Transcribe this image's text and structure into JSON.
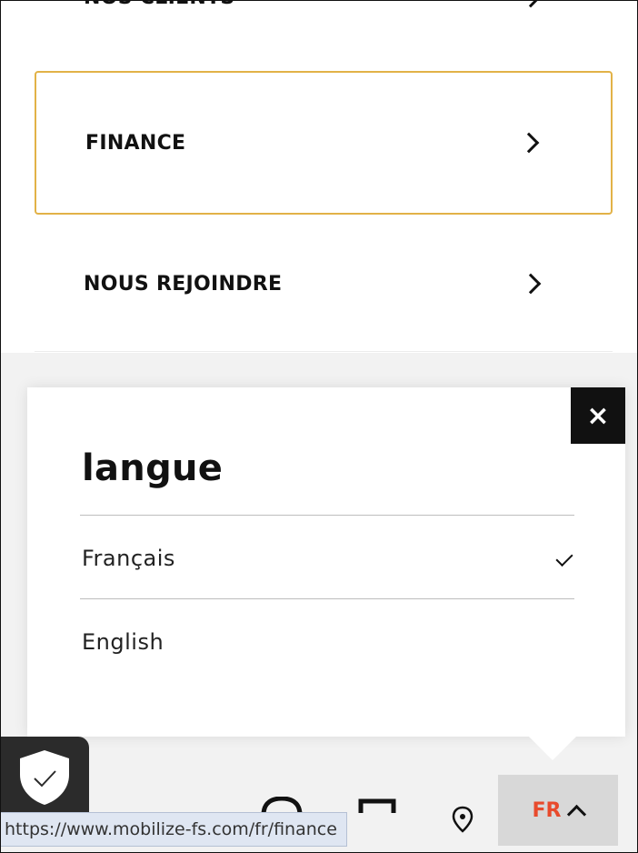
{
  "menu": {
    "items": [
      {
        "label": "NOS CLIENTS"
      },
      {
        "label": "FINANCE"
      },
      {
        "label": "NOUS REJOINDRE"
      }
    ]
  },
  "language_popup": {
    "title": "langue",
    "close_symbol": "×",
    "options": [
      {
        "label": "Français",
        "selected": true
      },
      {
        "label": "English",
        "selected": false
      }
    ]
  },
  "bottom_bar": {
    "language_code": "FR",
    "icons": [
      "shield-check-icon",
      "chat-icon",
      "document-icon",
      "location-pin-icon",
      "chevron-up-icon"
    ]
  },
  "status_url": "https://www.mobilize-fs.com/fr/finance",
  "colors": {
    "focus_border": "#e2b247",
    "language_code": "#e84a2c",
    "close_button_bg": "#111111",
    "tooltip_bg": "#dfe6f2"
  }
}
